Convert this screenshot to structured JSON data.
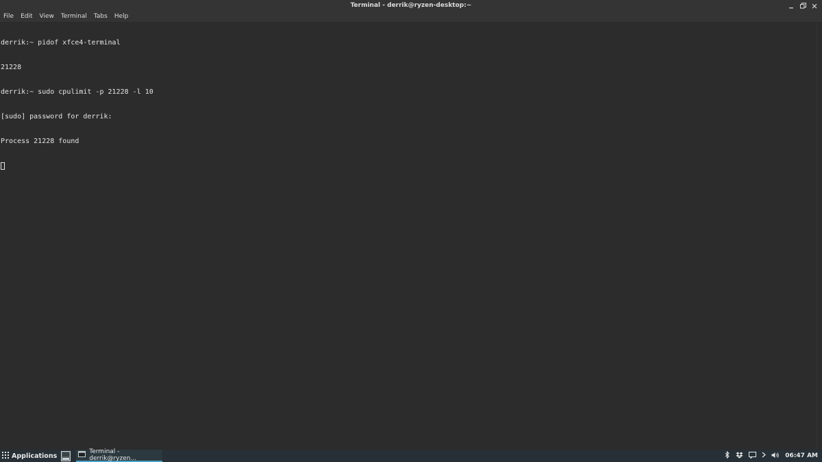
{
  "window": {
    "title": "Terminal - derrik@ryzen-desktop:~"
  },
  "menubar": {
    "items": [
      "File",
      "Edit",
      "View",
      "Terminal",
      "Tabs",
      "Help"
    ]
  },
  "terminal": {
    "lines": [
      "derrik:~ pidof xfce4-terminal",
      "21228",
      "derrik:~ sudo cpulimit -p 21228 -l 10",
      "[sudo] password for derrik:",
      "Process 21228 found"
    ]
  },
  "taskbar": {
    "applications_label": "Applications",
    "task_label": "Terminal - derrik@ryzen...",
    "clock": "06:47 AM",
    "tray_icons": [
      "bluetooth-icon",
      "dropbox-icon",
      "notification-icon",
      "chevron-right-icon",
      "volume-icon"
    ]
  },
  "colors": {
    "terminal_bg": "#2c2c2c",
    "taskbar_bg": "#263036",
    "accent": "#4aa3c8"
  }
}
